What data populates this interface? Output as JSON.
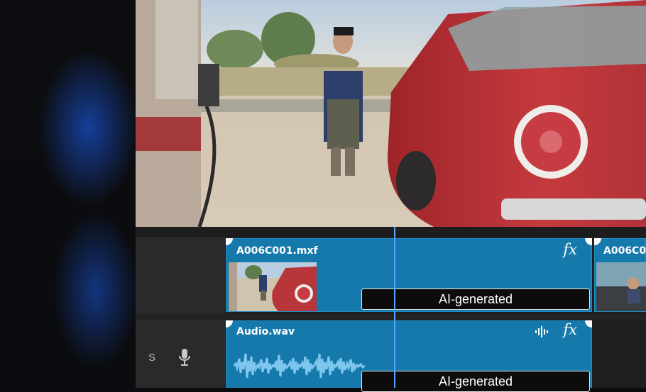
{
  "preview": {
    "scene": "video-frame-man-walking-toward-red-car-at-gas-station"
  },
  "tracks": {
    "video": {
      "clips": [
        {
          "name": "A006C001.mxf",
          "fx": "fx",
          "badge": "AI-generated",
          "color": "#1679ab"
        },
        {
          "name": "A006C0",
          "fx": "",
          "badge": "",
          "color": "#1679ab"
        }
      ]
    },
    "audio": {
      "header_label": "S",
      "header_icon": "microphone-icon",
      "clips": [
        {
          "name": "Audio.wav",
          "fx": "fx",
          "badge": "AI-generated",
          "color": "#1679ab",
          "icon": "waveform-icon"
        }
      ]
    }
  },
  "colors": {
    "playhead": "#5aa2ff",
    "clip_fill": "#1679ab",
    "waveform": "#7fc6ee"
  }
}
